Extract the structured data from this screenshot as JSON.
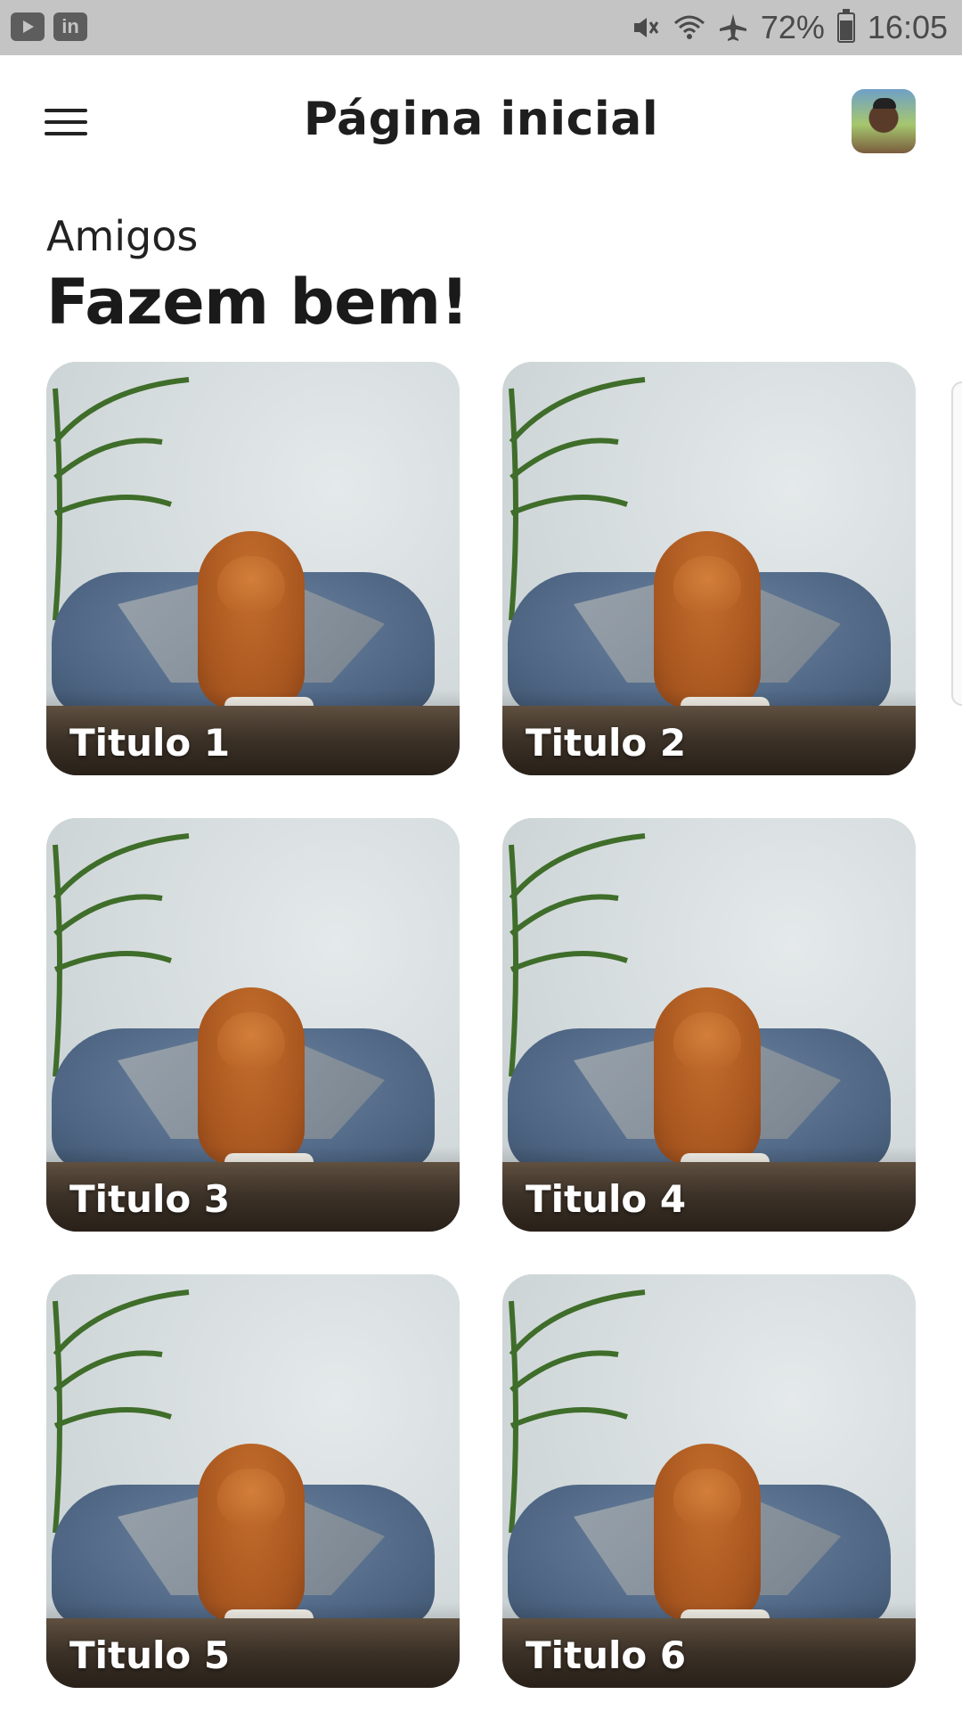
{
  "statusbar": {
    "left_icons": [
      "youtube-icon",
      "linkedin-icon"
    ],
    "linkedin_label": "in",
    "battery_percent": "72%",
    "battery_level": 0.72,
    "time": "16:05"
  },
  "appbar": {
    "title": "Página inicial"
  },
  "intro": {
    "subtitle": "Amigos",
    "headline": "Fazem bem!"
  },
  "cards": [
    {
      "title": "Titulo 1"
    },
    {
      "title": "Titulo 2"
    },
    {
      "title": "Titulo 3"
    },
    {
      "title": "Titulo 4"
    },
    {
      "title": "Titulo 5"
    },
    {
      "title": "Titulo 6"
    }
  ],
  "colors": {
    "statusbar_bg": "#c4c4c4",
    "text": "#1e1e1e",
    "card_title": "#ffffff"
  }
}
